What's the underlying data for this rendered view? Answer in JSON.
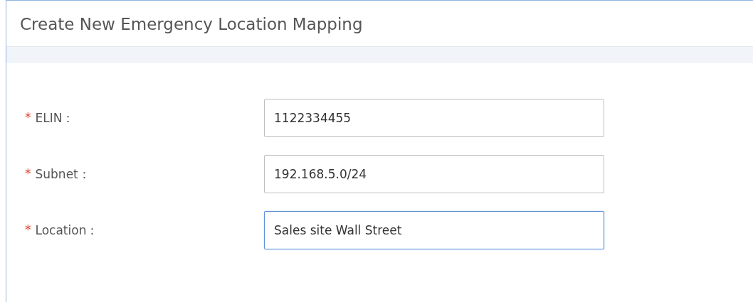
{
  "dialog": {
    "title": "Create New Emergency Location Mapping"
  },
  "fields": [
    {
      "required_mark": "*",
      "label": "ELIN：",
      "value": "1122334455",
      "focused": false
    },
    {
      "required_mark": "*",
      "label": "Subnet：",
      "value": "192.168.5.0/24",
      "focused": false
    },
    {
      "required_mark": "*",
      "label": "Location：",
      "value": "Sales site Wall Street",
      "focused": true
    }
  ]
}
